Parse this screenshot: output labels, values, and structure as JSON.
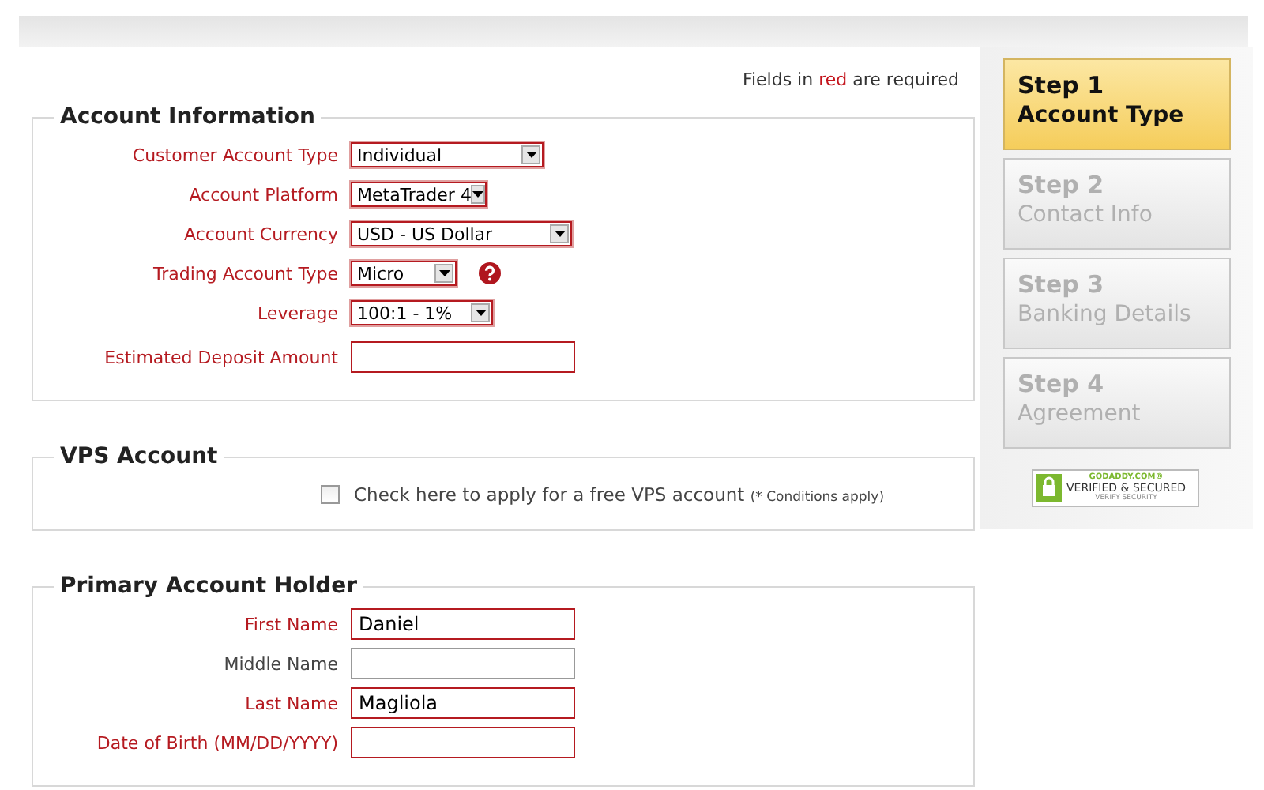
{
  "required_note": {
    "before": "Fields in",
    "highlight": "red",
    "after": "are required"
  },
  "sections": [
    {
      "title": "Account Information",
      "rows": [
        {
          "kind": "select",
          "label": "Customer Account Type",
          "required": true,
          "value": "Individual"
        },
        {
          "kind": "select",
          "label": "Account Platform",
          "required": true,
          "value": "MetaTrader 4"
        },
        {
          "kind": "select",
          "label": "Account Currency",
          "required": true,
          "value": "USD - US Dollar"
        },
        {
          "kind": "select",
          "label": "Trading Account Type",
          "required": true,
          "value": "Micro",
          "help": true
        },
        {
          "kind": "select",
          "label": "Leverage",
          "required": true,
          "value": "100:1 - 1%"
        },
        {
          "kind": "input",
          "label": "Estimated Deposit Amount",
          "required": true
        }
      ]
    },
    {
      "title": "VPS Account",
      "rows": [
        {
          "kind": "checkbox",
          "checked": false,
          "label": "Check here to apply for a free VPS account",
          "note": "(* Conditions apply)"
        }
      ]
    },
    {
      "title": "Primary Account Holder",
      "rows": [
        {
          "kind": "input",
          "label": "First Name",
          "required": true,
          "value": "Daniel"
        },
        {
          "kind": "input",
          "label": "Middle Name",
          "required": false
        },
        {
          "kind": "input",
          "label": "Last Name",
          "required": true,
          "value": "Magliola"
        },
        {
          "kind": "input",
          "label": "Date of Birth (MM/DD/YYYY)",
          "required": true
        }
      ]
    }
  ],
  "steps": [
    {
      "step": "Step 1",
      "name": "Account Type",
      "selected": true
    },
    {
      "step": "Step 2",
      "name": "Contact Info",
      "selected": false
    },
    {
      "step": "Step 3",
      "name": "Banking Details",
      "selected": false
    },
    {
      "step": "Step 4",
      "name": "Agreement",
      "selected": false
    }
  ],
  "seal": {
    "brand": "GODADDY.COM®",
    "title": "VERIFIED & SECURED",
    "subtitle": "VERIFY SECURITY"
  }
}
